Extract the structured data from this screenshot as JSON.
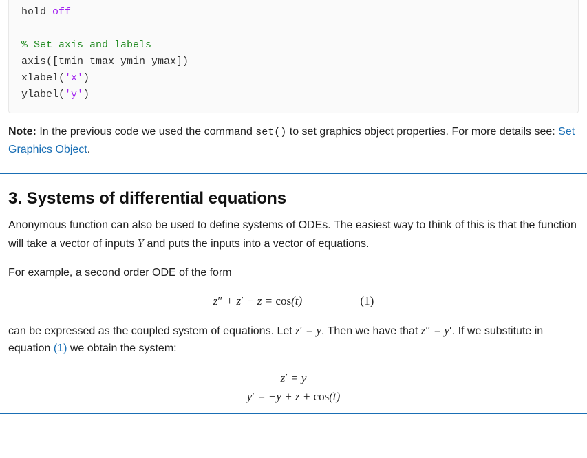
{
  "code": {
    "l1a": "hold ",
    "l1b": "off",
    "l2": "",
    "l3": "% Set axis and labels",
    "l4": "axis([tmin tmax ymin ymax])",
    "l5a": "xlabel(",
    "l5b": "'x'",
    "l5c": ")",
    "l6a": "ylabel(",
    "l6b": "'y'",
    "l6c": ")"
  },
  "note": {
    "label": "Note:",
    "text1": " In the previous code we used the command ",
    "cmd": "set()",
    "text2": " to set graphics object properties. For more details see: ",
    "link": "Set Graphics Object",
    "text3": "."
  },
  "section": {
    "title": "3. Systems of differential equations",
    "p1a": "Anonymous function can also be used to define systems of ODEs. The easiest way to think of this is that the function will take a vector of inputs ",
    "p1var": "Y",
    "p1b": " and puts the inputs into a vector of equations.",
    "p2": "For example, a second order ODE of the form",
    "eq1": "z″ + z′ − z = cos(t)",
    "eq1num": "(1)",
    "p3a": "can be expressed as the coupled system of equations. Let ",
    "p3m1": "z′ = y",
    "p3b": ". Then we have that ",
    "p3m2": "z″ = y′",
    "p3c": ". If we substitute in equation ",
    "p3ref": "(1)",
    "p3d": " we obtain the system:",
    "sys1": "z′ = y",
    "sys2": "y′ = −y + z + cos(t)"
  }
}
